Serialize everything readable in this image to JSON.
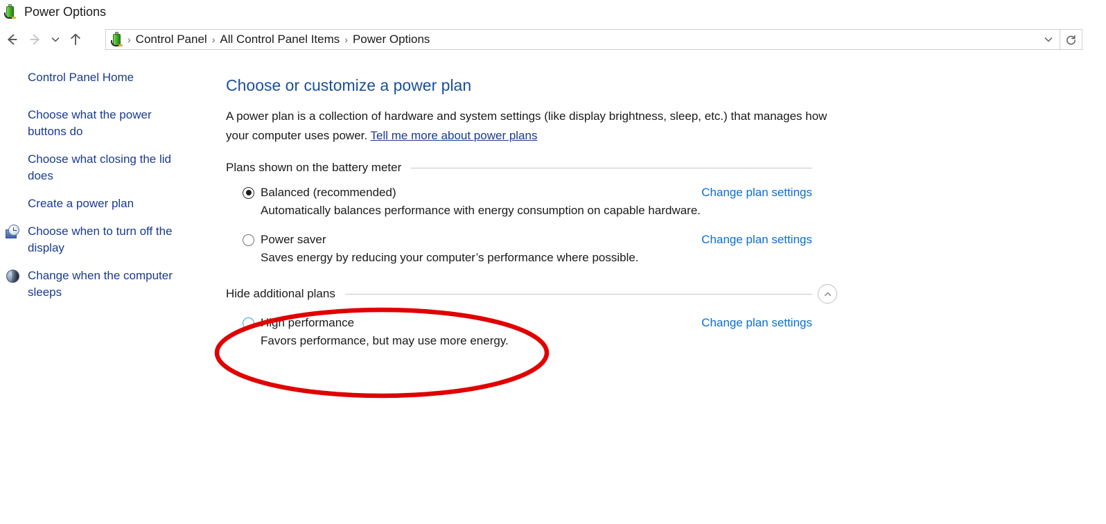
{
  "window": {
    "title": "Power Options",
    "title_icon": "power-battery-icon"
  },
  "toolbar": {
    "back_icon": "back-arrow-icon",
    "forward_icon": "forward-arrow-icon",
    "history_icon": "chevron-down-icon",
    "up_icon": "up-arrow-icon",
    "refresh_icon": "refresh-icon",
    "address_dropdown_icon": "chevron-down-icon"
  },
  "breadcrumb": {
    "icon": "power-battery-icon",
    "separator": "›",
    "items": [
      {
        "label": "Control Panel"
      },
      {
        "label": "All Control Panel Items"
      },
      {
        "label": "Power Options"
      }
    ]
  },
  "sidebar": {
    "items": [
      {
        "label": "Control Panel Home",
        "icon": null
      },
      {
        "label": "Choose what the power buttons do",
        "icon": null
      },
      {
        "label": "Choose what closing the lid does",
        "icon": null
      },
      {
        "label": "Create a power plan",
        "icon": null
      },
      {
        "label": "Choose when to turn off the display",
        "icon": "display-clock-icon"
      },
      {
        "label": "Change when the computer sleeps",
        "icon": "sleep-moon-icon"
      }
    ]
  },
  "main": {
    "page_title": "Choose or customize a power plan",
    "intro_text_1": "A power plan is a collection of hardware and system settings (like display brightness, sleep, etc.) that manages how your computer uses power. ",
    "intro_link": "Tell me more about power plans",
    "section_battery": "Plans shown on the battery meter",
    "section_additional": "Hide additional plans",
    "toggle_icon": "chevron-up-icon",
    "plans": [
      {
        "name": "Balanced (recommended)",
        "description": "Automatically balances performance with energy consumption on capable hardware.",
        "selected": true,
        "hovered": false,
        "link": "Change plan settings"
      },
      {
        "name": "Power saver",
        "description": "Saves energy by reducing your computer’s performance where possible.",
        "selected": false,
        "hovered": false,
        "link": "Change plan settings"
      }
    ],
    "additional_plans": [
      {
        "name": "High performance",
        "description": "Favors performance, but may use more energy.",
        "selected": false,
        "hovered": true,
        "link": "Change plan settings"
      }
    ]
  },
  "annotation": {
    "shape": "ellipse",
    "color": "#e00000",
    "stroke_width": 6,
    "target": "High performance plan option"
  },
  "colors": {
    "page_title": "#1a4f9c",
    "sidebar_link": "#1a3a8f",
    "action_link": "#0a6ed1",
    "text": "#1a1a1a",
    "rule": "#c8c8c8",
    "annotation_red": "#e00000",
    "radio_hover": "#3b9bdd"
  }
}
